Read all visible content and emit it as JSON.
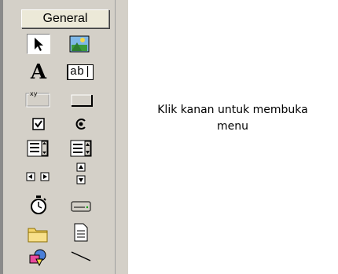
{
  "toolbox": {
    "tab_label": "General",
    "tools": [
      {
        "icon": "pointer-icon"
      },
      {
        "icon": "picturebox-icon"
      },
      {
        "icon": "label-icon"
      },
      {
        "icon": "textbox-icon"
      },
      {
        "icon": "frame-icon"
      },
      {
        "icon": "commandbutton-icon"
      },
      {
        "icon": "checkbox-icon"
      },
      {
        "icon": "optionbutton-icon"
      },
      {
        "icon": "combobox-icon"
      },
      {
        "icon": "listbox-icon"
      },
      {
        "icon": "hscrollbar-icon"
      },
      {
        "icon": "vscrollbar-icon"
      },
      {
        "icon": "timer-icon"
      },
      {
        "icon": "drivelistbox-icon"
      },
      {
        "icon": "dirlistbox-icon"
      },
      {
        "icon": "filelistbox-icon"
      },
      {
        "icon": "shape-icon"
      },
      {
        "icon": "line-icon"
      }
    ],
    "label_glyph": "A",
    "textbox_text": "ab|",
    "frame_caption": "xy"
  },
  "hint_text": "Klik kanan untuk membuka menu"
}
